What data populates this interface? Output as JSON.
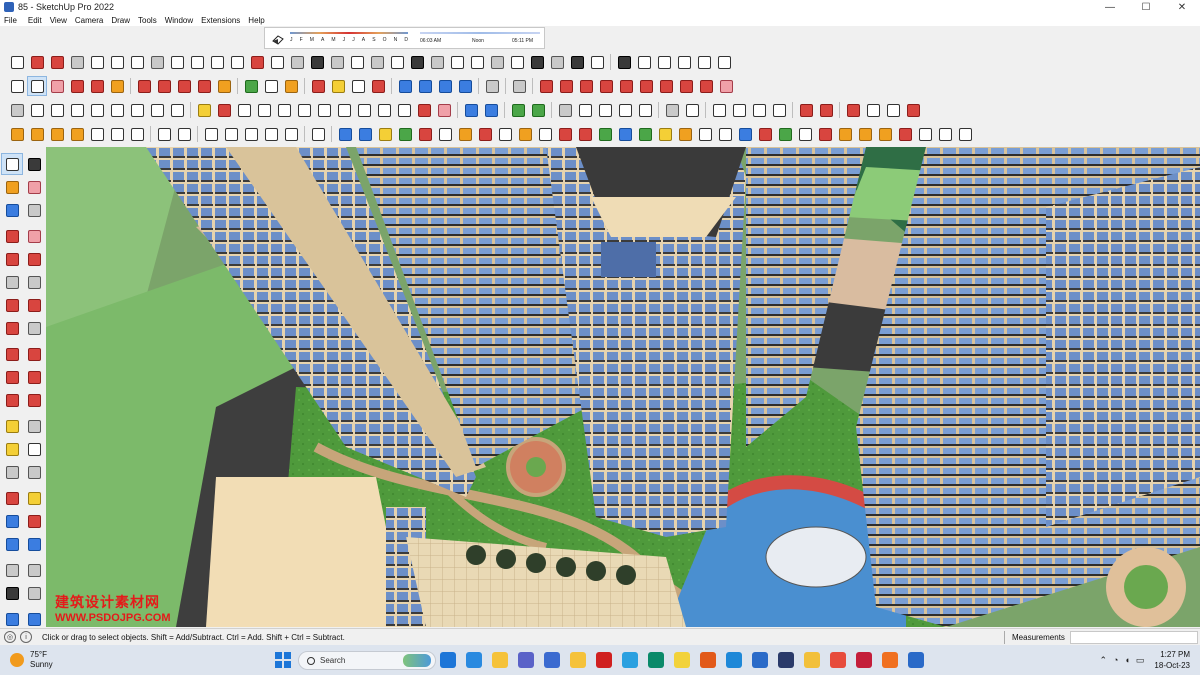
{
  "window": {
    "title": "85 - SketchUp Pro 2022",
    "buttons": [
      "—",
      "☐",
      "✕"
    ]
  },
  "menu": [
    "File",
    "Edit",
    "View",
    "Camera",
    "Draw",
    "Tools",
    "Window",
    "Extensions",
    "Help"
  ],
  "shadow": {
    "months": [
      "J",
      "F",
      "M",
      "A",
      "M",
      "J",
      "J",
      "A",
      "S",
      "O",
      "N",
      "D"
    ],
    "sunrise": "06:03 AM",
    "noon": "Noon",
    "sunset": "05:11 PM"
  },
  "status": {
    "text": "Click or drag to select objects. Shift = Add/Subtract. Ctrl = Add. Shift + Ctrl = Subtract.",
    "measurements_label": "Measurements",
    "measurements_value": ""
  },
  "watermark": {
    "line1": "建筑设计素材网",
    "line2": "WWW.PSDOJPG.COM"
  },
  "taskbar": {
    "temperature": "75°F",
    "condition": "Sunny",
    "search_placeholder": "Search",
    "time": "1:27 PM",
    "date": "18-Oct-23",
    "apps": [
      "Windows",
      "Edge",
      "Explorer",
      "Teams",
      "Store",
      "Explorer2",
      "Opera",
      "Telegram",
      "Publisher",
      "Notes",
      "Brave",
      "VS Code",
      "SketchUp",
      "Photoshop",
      "Drive",
      "Chrome",
      "Pinterest",
      "Firefox",
      "SketchUp2"
    ]
  },
  "colors": {
    "accent": "#1d76d8",
    "selection": "#cfe3f7",
    "viewport_bg": "#8aa67a"
  }
}
